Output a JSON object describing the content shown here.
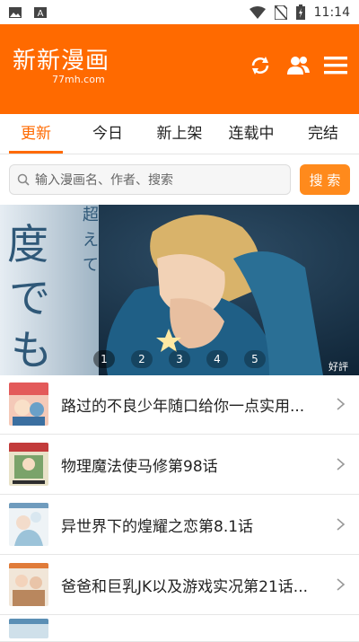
{
  "status_bar": {
    "time": "11:14",
    "left_icons": [
      "gallery-icon",
      "font-icon"
    ],
    "right_icons": [
      "wifi-icon",
      "no-sim-icon",
      "battery-icon"
    ]
  },
  "header": {
    "logo_title": "新新漫画",
    "logo_subtitle": "77mh.com",
    "bg_color": "#ff6a00",
    "icons": [
      "refresh-icon",
      "users-icon",
      "menu-icon"
    ]
  },
  "tabs": [
    {
      "label": "更新",
      "active": true
    },
    {
      "label": "今日",
      "active": false
    },
    {
      "label": "新上架",
      "active": false
    },
    {
      "label": "连载中",
      "active": false
    },
    {
      "label": "完结",
      "active": false
    }
  ],
  "search": {
    "placeholder": "输入漫画名、作者、搜索",
    "button_label": "搜 索"
  },
  "banner": {
    "dots": [
      "1",
      "2",
      "3",
      "4",
      "5"
    ],
    "active_index": 0,
    "overlay_text_left": "度でも",
    "overlay_text_right": "好評"
  },
  "list": [
    {
      "title": "路过的不良少年随口给你一点实用..."
    },
    {
      "title": "物理魔法使马修第98话"
    },
    {
      "title": "异世界下的煌耀之恋第8.1话"
    },
    {
      "title": "爸爸和巨乳JK以及游戏实况第21话..."
    }
  ]
}
